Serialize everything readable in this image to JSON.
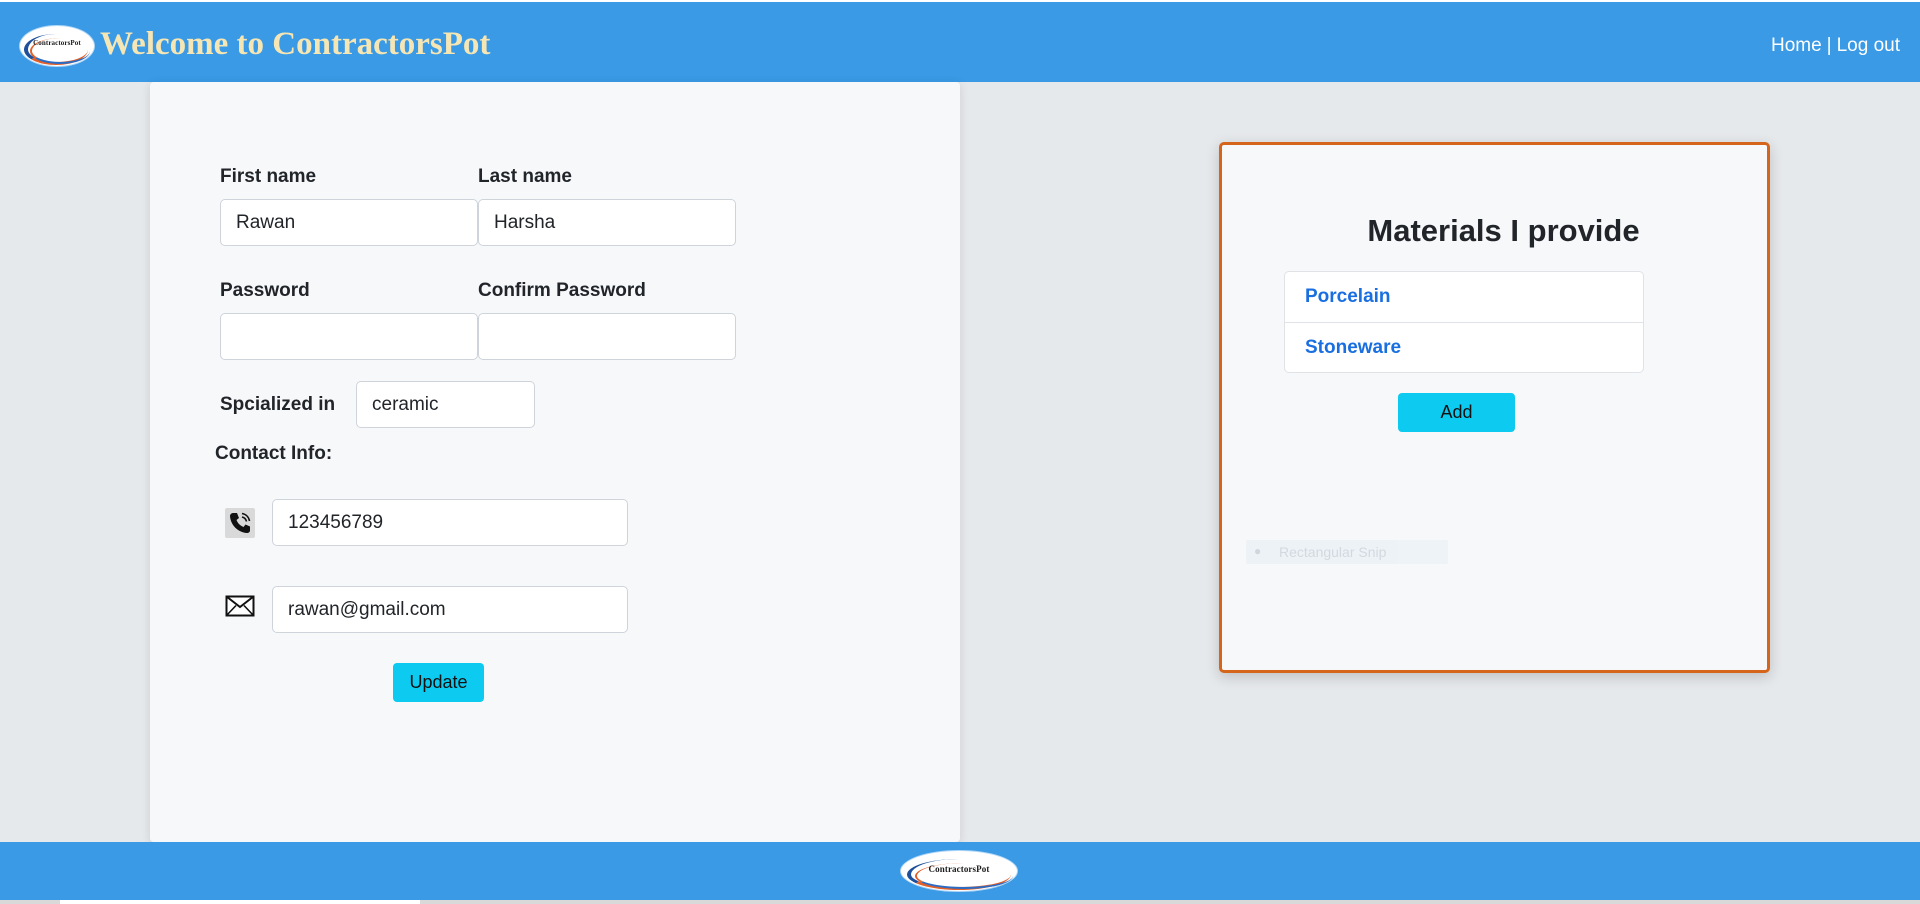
{
  "header": {
    "logo_text": "ContractorsPot",
    "title": "Welcome to ContractorsPot",
    "nav": {
      "home": "Home",
      "separator": "|",
      "logout": "Log out"
    }
  },
  "form": {
    "first_name_label": "First name",
    "first_name_value": "Rawan",
    "last_name_label": "Last name",
    "last_name_value": "Harsha",
    "password_label": "Password",
    "password_value": "",
    "confirm_password_label": "Confirm Password",
    "confirm_password_value": "",
    "specialized_label": "Spcialized in",
    "specialized_value": "ceramic",
    "contact_label": "Contact Info:",
    "phone_icon": "phone-icon",
    "phone_value": "123456789",
    "email_icon": "envelope-icon",
    "email_value": "rawan@gmail.com",
    "update_label": "Update"
  },
  "materials": {
    "title": "Materials I provide",
    "items": [
      {
        "label": "Porcelain"
      },
      {
        "label": "Stoneware"
      }
    ],
    "add_label": "Add",
    "snip_overlay_text": "Rectangular Snip"
  },
  "footer": {
    "logo_text": "ContractorsPot"
  },
  "colors": {
    "header_bg": "#3a9ae6",
    "title_color": "#f6e6b4",
    "button_bg": "#0dcaf0",
    "card_border": "#d4651b",
    "link_color": "#1a6fe0",
    "page_bg": "#e6e9ec"
  }
}
